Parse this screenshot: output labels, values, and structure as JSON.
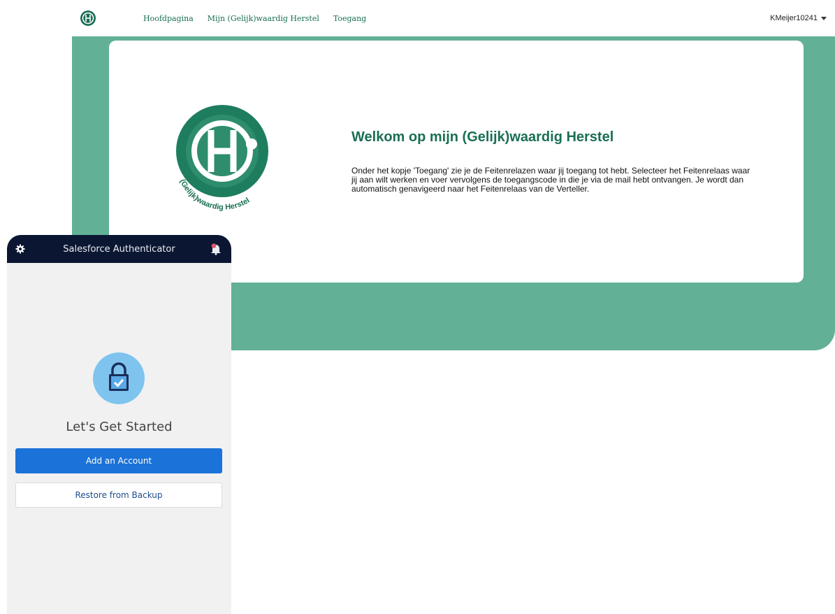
{
  "nav": {
    "links": [
      "Hoofdpagina",
      "Mijn (Gelijk)waardig Herstel",
      "Toegang"
    ],
    "user": "KMeijer10241"
  },
  "main": {
    "title": "Welkom op mijn (Gelijk)waardig Herstel",
    "body": "Onder het kopje 'Toegang' zie je de Feitenrelazen waar jij toegang tot hebt. Selecteer het Feitenrelaas waar jij aan wilt werken en voer vervolgens de toegangscode in die je via de mail hebt ontvangen. Je wordt dan automatisch genavigeerd naar het Feitenrelaas van de Verteller.",
    "logo_text": "(Gelijk)waardig Herstel"
  },
  "phone": {
    "title": "Salesforce Authenticator",
    "heading": "Let's Get Started",
    "primary_button": "Add an Account",
    "secondary_button": "Restore from Backup"
  },
  "colors": {
    "brand_green": "#1a6e55",
    "hero_green": "#62b196",
    "phone_header": "#0b1732",
    "primary_blue": "#1b72d8"
  }
}
